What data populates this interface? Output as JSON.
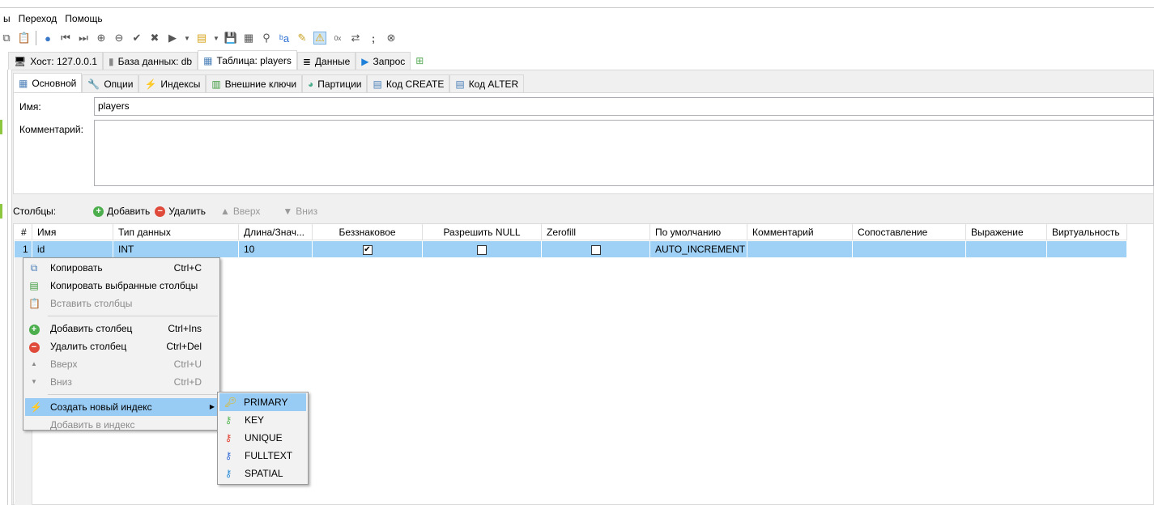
{
  "menubar": [
    "ы",
    "Переход",
    "Помощь"
  ],
  "toolbar_icons": [
    "copy-icon",
    "paste-icon",
    "help-icon",
    "first-icon",
    "last-icon",
    "add-icon",
    "remove-icon",
    "ok-icon",
    "cancel-icon",
    "run-icon",
    "dropdown-icon",
    "query-icon",
    "dropdown-icon",
    "save-icon",
    "saveas-icon",
    "find-icon",
    "replace-icon",
    "edit-icon",
    "warning-icon",
    "hex-icon",
    "wrap-icon",
    "semicolon-icon",
    "stop-icon"
  ],
  "main_tabs": [
    {
      "label": "Хост: 127.0.0.1"
    },
    {
      "label": "База данных: db"
    },
    {
      "label": "Таблица: players",
      "active": true
    },
    {
      "label": "Данные"
    },
    {
      "label": "Запрос"
    }
  ],
  "sub_tabs": [
    {
      "label": "Основной",
      "active": true
    },
    {
      "label": "Опции"
    },
    {
      "label": "Индексы"
    },
    {
      "label": "Внешние ключи"
    },
    {
      "label": "Партиции"
    },
    {
      "label": "Код CREATE"
    },
    {
      "label": "Код ALTER"
    }
  ],
  "form": {
    "name_label": "Имя:",
    "name_value": "players",
    "comment_label": "Комментарий:",
    "comment_value": ""
  },
  "columns_toolbar": {
    "label": "Столбцы:",
    "add": "Добавить",
    "delete": "Удалить",
    "up": "Вверх",
    "down": "Вниз"
  },
  "table": {
    "headers": [
      "#",
      "Имя",
      "Тип данных",
      "Длина/Знач...",
      "Беззнаковое",
      "Разрешить NULL",
      "Zerofill",
      "По умолчанию",
      "Комментарий",
      "Сопоставление",
      "Выражение",
      "Виртуальность"
    ],
    "rows": [
      {
        "num": "1",
        "name": "id",
        "type": "INT",
        "length": "10",
        "unsigned": true,
        "allow_null": false,
        "zerofill": false,
        "default": "AUTO_INCREMENT",
        "comment": "",
        "collation": "",
        "expression": "",
        "virtuality": ""
      }
    ]
  },
  "context_menu": [
    {
      "label": "Копировать",
      "shortcut": "Ctrl+C",
      "enabled": true
    },
    {
      "label": "Копировать выбранные столбцы",
      "shortcut": "",
      "enabled": true
    },
    {
      "label": "Вставить столбцы",
      "shortcut": "",
      "enabled": false
    },
    {
      "label": "Добавить столбец",
      "shortcut": "Ctrl+Ins",
      "enabled": true
    },
    {
      "label": "Удалить столбец",
      "shortcut": "Ctrl+Del",
      "enabled": true
    },
    {
      "label": "Вверх",
      "shortcut": "Ctrl+U",
      "enabled": false
    },
    {
      "label": "Вниз",
      "shortcut": "Ctrl+D",
      "enabled": false
    },
    {
      "label": "Создать новый индекс",
      "shortcut": "",
      "enabled": true,
      "highlighted": true
    },
    {
      "label": "Добавить в индекс",
      "shortcut": "",
      "enabled": false
    }
  ],
  "submenu": [
    {
      "label": "PRIMARY",
      "color": "#e8b400"
    },
    {
      "label": "KEY",
      "color": "#5cb85c"
    },
    {
      "label": "UNIQUE",
      "color": "#e04030"
    },
    {
      "label": "FULLTEXT",
      "color": "#3a6fd8"
    },
    {
      "label": "SPATIAL",
      "color": "#2f8fd8"
    }
  ]
}
